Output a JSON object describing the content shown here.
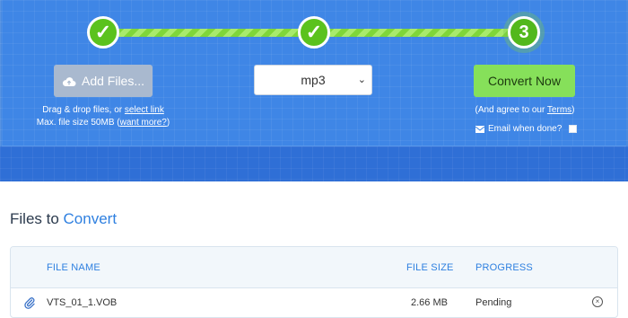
{
  "steps": {
    "step1_symbol": "✓",
    "step2_symbol": "✓",
    "step3_number": "3"
  },
  "upload": {
    "add_files_label": "Add Files...",
    "hint_line1_prefix": "Drag & drop files, or ",
    "hint_line1_link": "select link",
    "hint_line2_prefix": "Max. file size 50MB (",
    "hint_line2_link": "want more?",
    "hint_line2_suffix": ")"
  },
  "format": {
    "selected": "mp3",
    "chevron": "⌄"
  },
  "convert": {
    "button_label": "Convert Now",
    "agree_prefix": "(And agree to our ",
    "agree_link": "Terms",
    "agree_suffix": ")",
    "email_label": "Email when done?"
  },
  "files": {
    "title_prefix": "Files to ",
    "title_accent": "Convert",
    "columns": [
      "FILE NAME",
      "FILE SIZE",
      "PROGRESS"
    ],
    "rows": [
      {
        "name": "VTS_01_1.VOB",
        "size": "2.66 MB",
        "progress": "Pending",
        "remove": "×"
      }
    ]
  },
  "colors": {
    "panel_blue": "#3f86e6",
    "step_green": "#5bc21e",
    "convert_green": "#86e05a",
    "accent_blue": "#2f80e0"
  },
  "icons": [
    "check-icon",
    "upload-cloud-icon",
    "chevron-down-icon",
    "envelope-icon",
    "paperclip-icon",
    "remove-icon"
  ]
}
